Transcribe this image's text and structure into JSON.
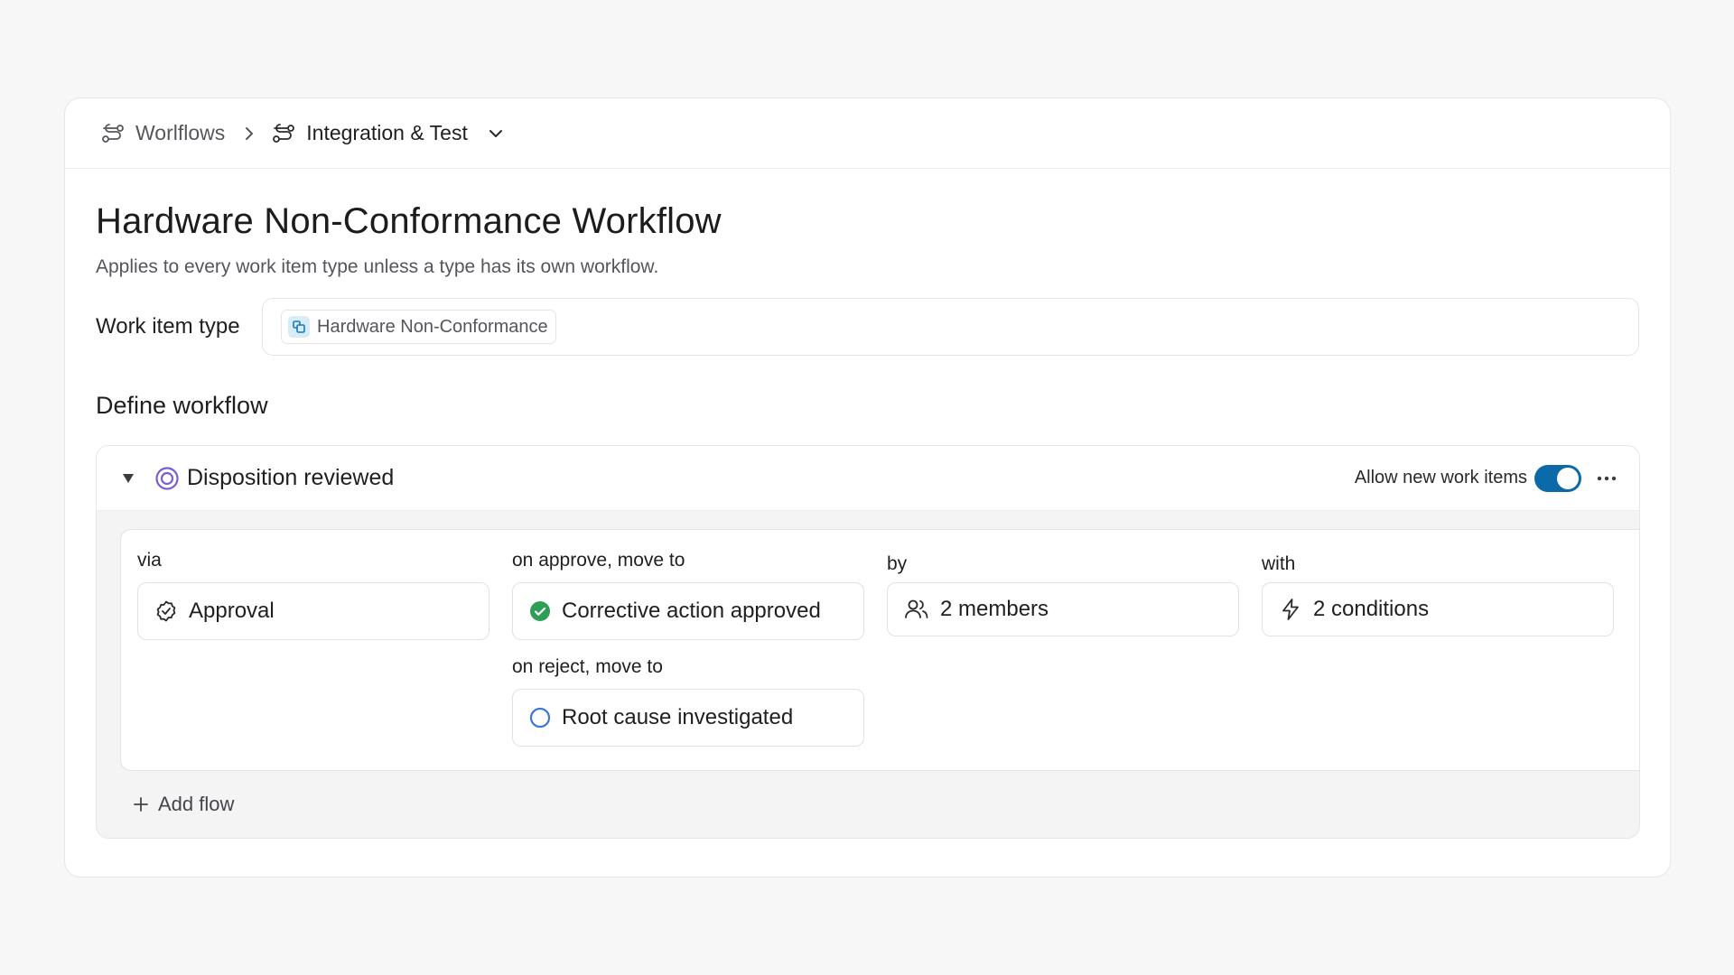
{
  "breadcrumb": {
    "root": "Worlflows",
    "current": "Integration & Test"
  },
  "page": {
    "title": "Hardware Non-Conformance Workflow",
    "subtitle": "Applies to every work item type unless a type has its own workflow."
  },
  "work_item_type": {
    "label": "Work item type",
    "value": "Hardware Non-Conformance"
  },
  "define_workflow": {
    "title": "Define workflow"
  },
  "state": {
    "name": "Disposition reviewed",
    "allow_label": "Allow new work items",
    "allow_enabled": true,
    "accent_color": "#7b5cd6"
  },
  "flow": {
    "via_label": "via",
    "via_value": "Approval",
    "approve_label": "on approve, move to",
    "approve_value": "Corrective action approved",
    "approve_color": "#2e9e55",
    "reject_label": "on reject, move to",
    "reject_value": "Root cause investigated",
    "reject_color": "#3a78d1",
    "by_label": "by",
    "by_value": "2 members",
    "with_label": "with",
    "with_value": "2 conditions"
  },
  "add_flow_label": "Add flow",
  "colors": {
    "toggle_on": "#0d6aa8"
  }
}
